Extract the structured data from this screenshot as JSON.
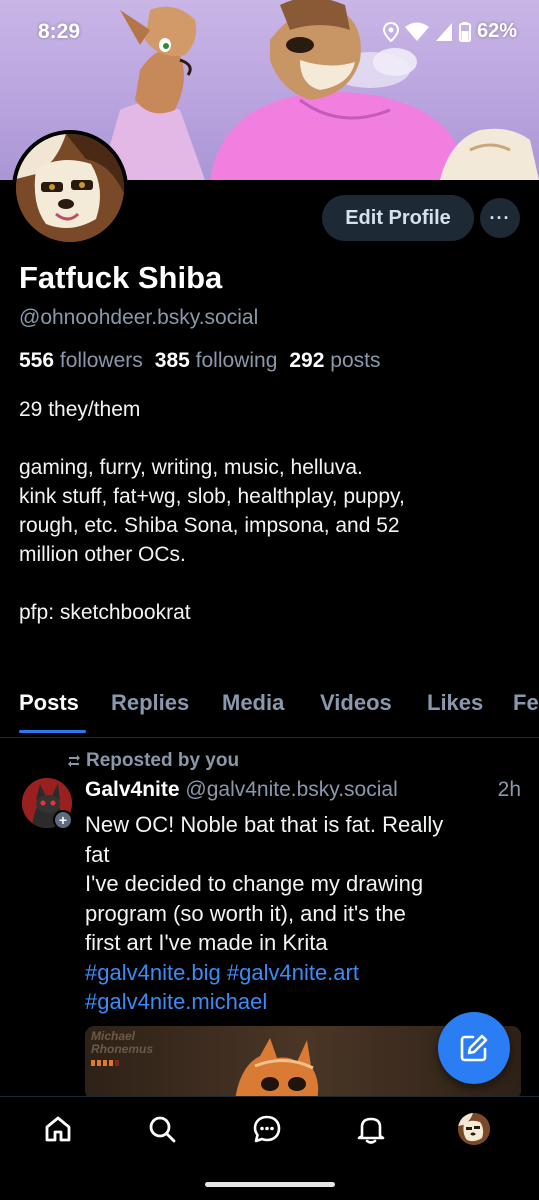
{
  "status_bar": {
    "time": "8:29",
    "battery": "62%"
  },
  "header": {
    "edit_profile_label": "Edit Profile",
    "more_label": "···"
  },
  "profile": {
    "display_name": "Fatfuck Shiba",
    "handle": "@ohnoohdeer.bsky.social",
    "followers_count": "556",
    "followers_label": "followers",
    "following_count": "385",
    "following_label": "following",
    "posts_count": "292",
    "posts_label": "posts",
    "bio_lines": [
      "29 they/them",
      "",
      "gaming, furry, writing, music, helluva.",
      "kink stuff, fat+wg, slob, healthplay, puppy,",
      "rough, etc. Shiba Sona, impsona, and 52",
      "million other OCs.",
      "",
      "pfp: sketchbookrat"
    ]
  },
  "tabs": [
    {
      "label": "Posts",
      "active": true
    },
    {
      "label": "Replies",
      "active": false
    },
    {
      "label": "Media",
      "active": false
    },
    {
      "label": "Videos",
      "active": false
    },
    {
      "label": "Likes",
      "active": false
    },
    {
      "label": "Fe",
      "active": false
    }
  ],
  "post": {
    "repost_label": "Reposted by you",
    "author": "Galv4nite",
    "author_handle": "@galv4nite.bsky.social",
    "time": "2h",
    "text_lines": [
      "New OC! Noble bat that is fat. Really",
      "fat",
      "I've decided to change my drawing",
      "program (so worth it), and it's the",
      "first art I've made in Krita"
    ],
    "hashtags_line1": "#galv4nite.big #galv4nite.art",
    "hashtags_line2": "#galv4nite.michael",
    "image_label_line1": "Michael",
    "image_label_line2": "Rhonemus"
  },
  "colors": {
    "accent": "#2a7df2",
    "hashtag": "#3b8cf5",
    "muted_text": "#8a98ab",
    "button_bg": "#1e2936",
    "background": "#000000"
  },
  "icons": {
    "nav": [
      "home-icon",
      "search-icon",
      "chat-icon",
      "bell-icon",
      "profile-avatar"
    ],
    "fab": "compose-icon"
  }
}
